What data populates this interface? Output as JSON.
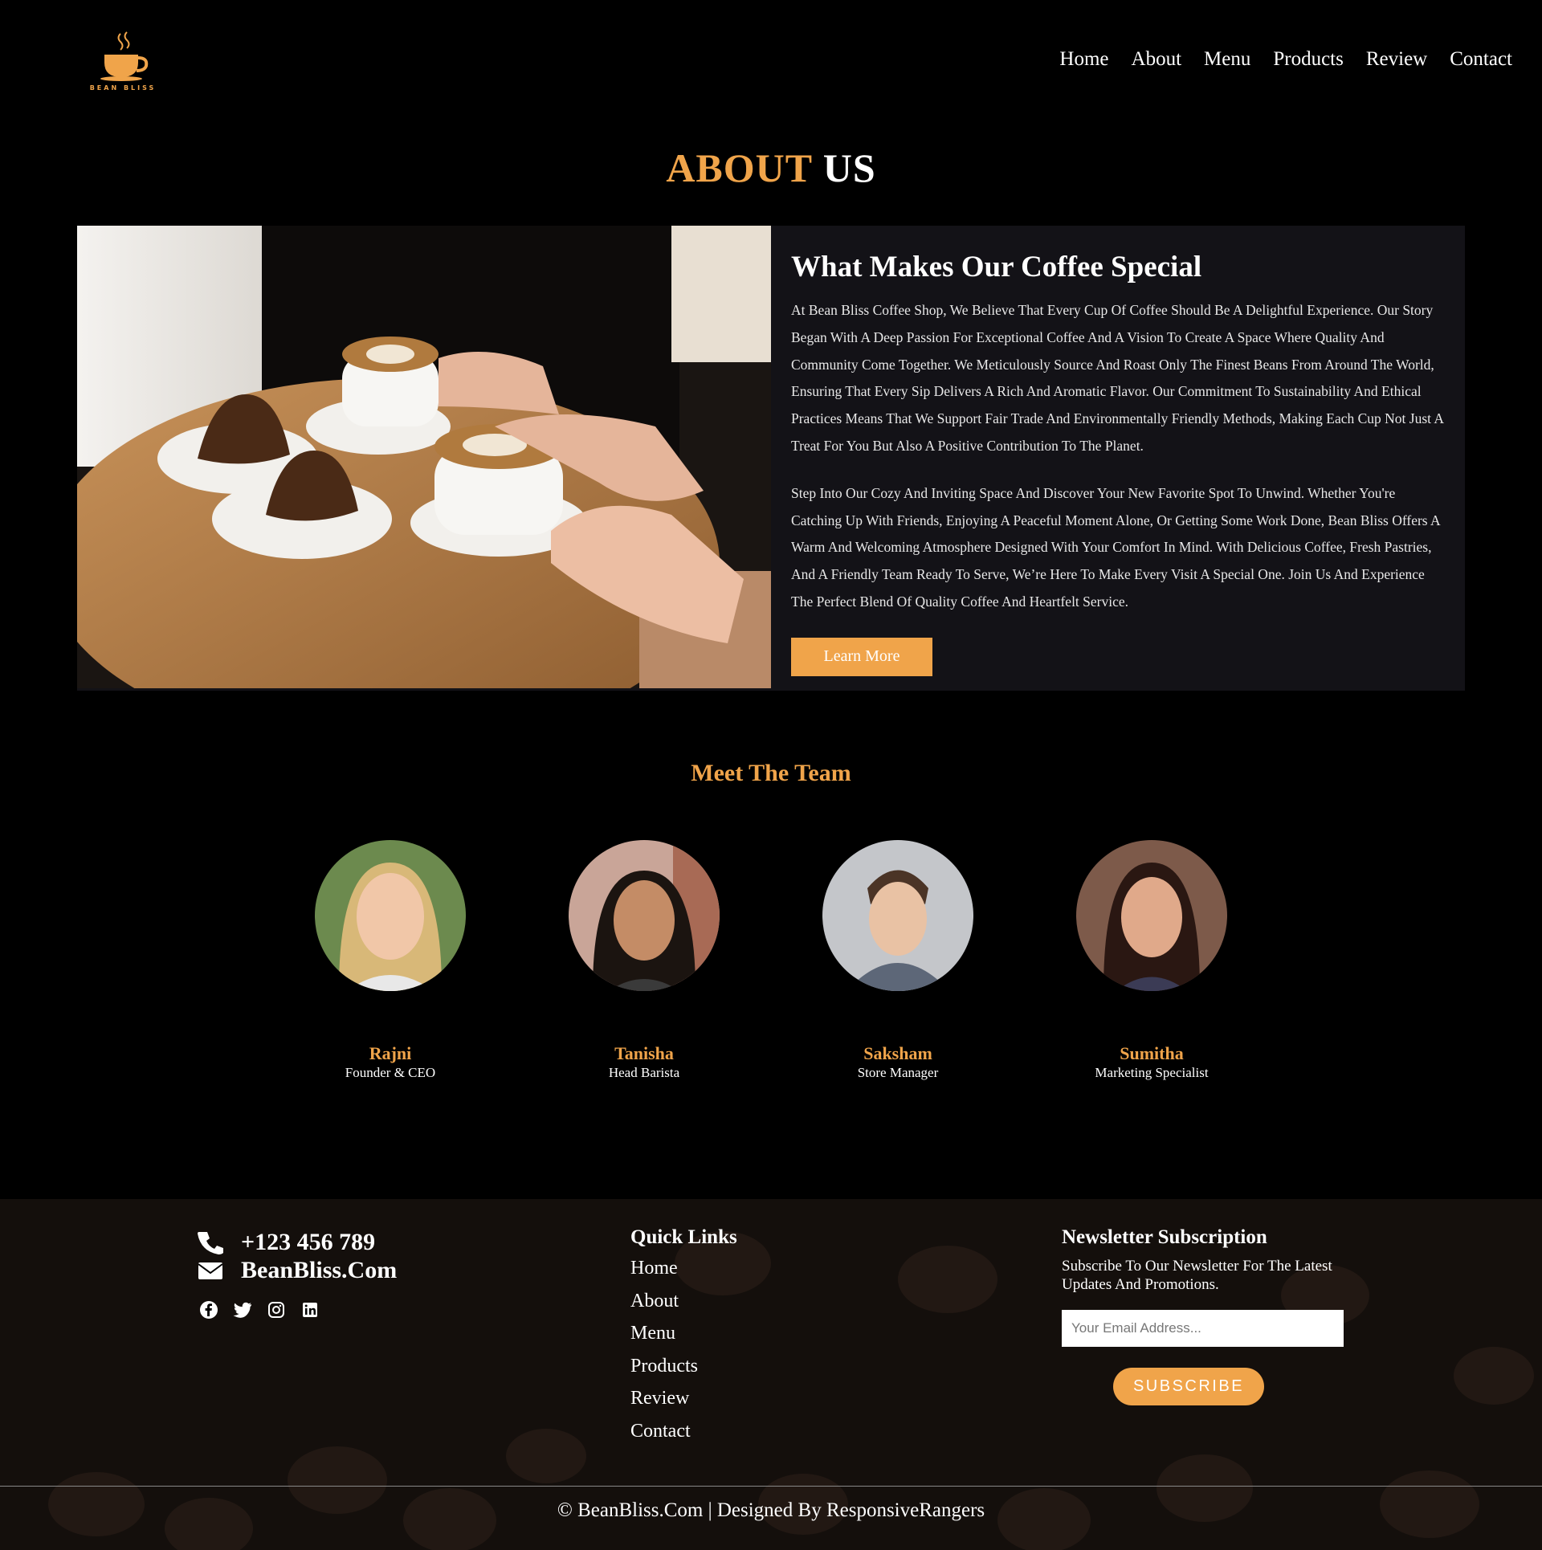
{
  "brand": {
    "logo_text": "BEAN BLISS",
    "accent_color": "#f0a44a"
  },
  "nav": {
    "items": [
      "Home",
      "About",
      "Menu",
      "Products",
      "Review",
      "Contact"
    ]
  },
  "about": {
    "title_accent": "ABOUT",
    "title_rest": "US",
    "heading": "What Makes Our Coffee Special",
    "paragraph1": "At Bean Bliss Coffee Shop, We Believe That Every Cup Of Coffee Should Be A Delightful Experience. Our Story Began With A Deep Passion For Exceptional Coffee And A Vision To Create A Space Where Quality And Community Come Together. We Meticulously Source And Roast Only The Finest Beans From Around The World, Ensuring That Every Sip Delivers A Rich And Aromatic Flavor. Our Commitment To Sustainability And Ethical Practices Means That We Support Fair Trade And Environmentally Friendly Methods, Making Each Cup Not Just A Treat For You But Also A Positive Contribution To The Planet.",
    "paragraph2": "Step Into Our Cozy And Inviting Space And Discover Your New Favorite Spot To Unwind. Whether You're Catching Up With Friends, Enjoying A Peaceful Moment Alone, Or Getting Some Work Done, Bean Bliss Offers A Warm And Welcoming Atmosphere Designed With Your Comfort In Mind. With Delicious Coffee, Fresh Pastries, And A Friendly Team Ready To Serve, We’re Here To Make Every Visit A Special One. Join Us And Experience The Perfect Blend Of Quality Coffee And Heartfelt Service.",
    "button_label": "Learn More"
  },
  "team": {
    "title": "Meet The Team",
    "members": [
      {
        "name": "Rajni",
        "role": "Founder & CEO"
      },
      {
        "name": "Tanisha",
        "role": "Head Barista"
      },
      {
        "name": "Saksham",
        "role": "Store Manager"
      },
      {
        "name": "Sumitha",
        "role": "Marketing Specialist"
      }
    ]
  },
  "footer": {
    "phone": "+123 456 789",
    "email": "BeanBliss.Com",
    "socials": [
      "facebook-icon",
      "twitter-icon",
      "instagram-icon",
      "linkedin-icon"
    ],
    "quick_links_title": "Quick Links",
    "quick_links": [
      "Home",
      "About",
      "Menu",
      "Products",
      "Review",
      "Contact"
    ],
    "newsletter_title": "Newsletter Subscription",
    "newsletter_text": "Subscribe To Our Newsletter For The Latest Updates And Promotions.",
    "email_placeholder": "Your Email Address...",
    "subscribe_label": "SUBSCRIBE",
    "copyright": "© BeanBliss.Com | Designed By ResponsiveRangers"
  }
}
